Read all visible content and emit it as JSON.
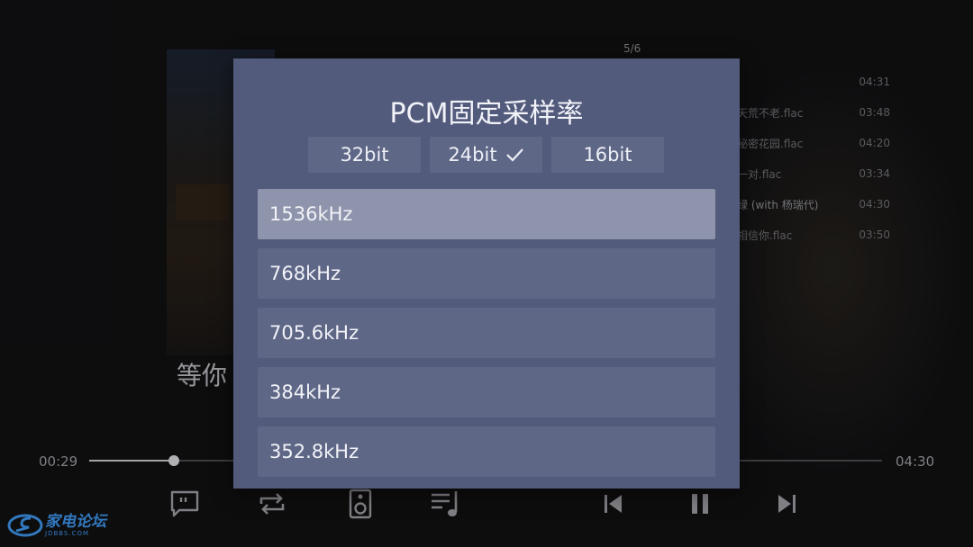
{
  "player": {
    "playlist_counter": "5/6",
    "playlist": [
      {
        "name": "",
        "duration": "04:31"
      },
      {
        "name": "天荒不老.flac",
        "duration": "03:48"
      },
      {
        "name": "秘密花园.flac",
        "duration": "04:20"
      },
      {
        "name": "一对.flac",
        "duration": "03:34"
      },
      {
        "name": "绿 (with 杨瑞代)",
        "duration": "04:30"
      },
      {
        "name": "相信你.flac",
        "duration": "03:50"
      }
    ],
    "lyric": "等你",
    "elapsed": "00:29",
    "total": "04:30",
    "progress_fraction": 0.107,
    "controls": [
      "lyrics-icon",
      "repeat-icon",
      "speaker-icon",
      "playlist-icon",
      "previous-icon",
      "pause-icon",
      "next-icon"
    ]
  },
  "watermark": {
    "text": "家电论坛",
    "sub": "JDBBS.COM"
  },
  "dialog": {
    "title": "PCM固定采样率",
    "bit_tabs": [
      {
        "label": "32bit",
        "selected": false
      },
      {
        "label": "24bit",
        "selected": true
      },
      {
        "label": "16bit",
        "selected": false
      }
    ],
    "rates": [
      {
        "label": "1536kHz",
        "selected": true
      },
      {
        "label": "768kHz",
        "selected": false
      },
      {
        "label": "705.6kHz",
        "selected": false
      },
      {
        "label": "384kHz",
        "selected": false
      },
      {
        "label": "352.8kHz",
        "selected": false
      }
    ]
  },
  "colors": {
    "dialog_bg": "#535b7d",
    "item_bg": "#5f6787",
    "item_selected_bg": "#8e94ab",
    "watermark": "#3e93e8"
  }
}
